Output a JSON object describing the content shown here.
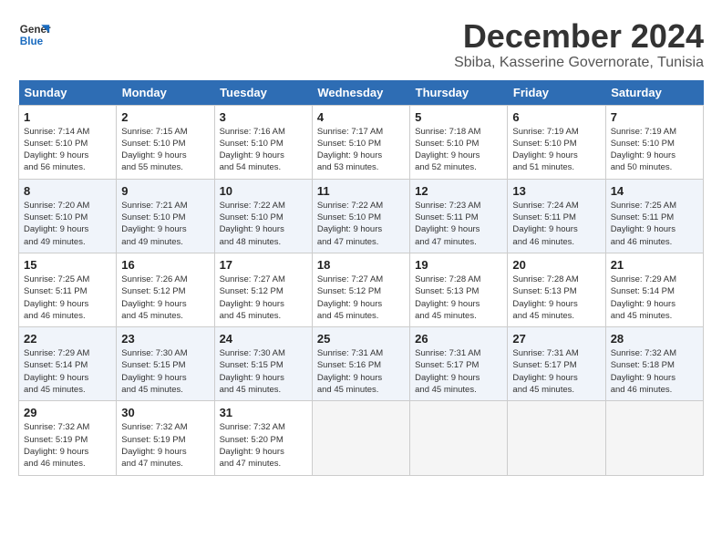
{
  "header": {
    "logo_line1": "General",
    "logo_line2": "Blue",
    "month": "December 2024",
    "location": "Sbiba, Kasserine Governorate, Tunisia"
  },
  "weekdays": [
    "Sunday",
    "Monday",
    "Tuesday",
    "Wednesday",
    "Thursday",
    "Friday",
    "Saturday"
  ],
  "weeks": [
    [
      {
        "day": "1",
        "info": "Sunrise: 7:14 AM\nSunset: 5:10 PM\nDaylight: 9 hours\nand 56 minutes."
      },
      {
        "day": "2",
        "info": "Sunrise: 7:15 AM\nSunset: 5:10 PM\nDaylight: 9 hours\nand 55 minutes."
      },
      {
        "day": "3",
        "info": "Sunrise: 7:16 AM\nSunset: 5:10 PM\nDaylight: 9 hours\nand 54 minutes."
      },
      {
        "day": "4",
        "info": "Sunrise: 7:17 AM\nSunset: 5:10 PM\nDaylight: 9 hours\nand 53 minutes."
      },
      {
        "day": "5",
        "info": "Sunrise: 7:18 AM\nSunset: 5:10 PM\nDaylight: 9 hours\nand 52 minutes."
      },
      {
        "day": "6",
        "info": "Sunrise: 7:19 AM\nSunset: 5:10 PM\nDaylight: 9 hours\nand 51 minutes."
      },
      {
        "day": "7",
        "info": "Sunrise: 7:19 AM\nSunset: 5:10 PM\nDaylight: 9 hours\nand 50 minutes."
      }
    ],
    [
      {
        "day": "8",
        "info": "Sunrise: 7:20 AM\nSunset: 5:10 PM\nDaylight: 9 hours\nand 49 minutes."
      },
      {
        "day": "9",
        "info": "Sunrise: 7:21 AM\nSunset: 5:10 PM\nDaylight: 9 hours\nand 49 minutes."
      },
      {
        "day": "10",
        "info": "Sunrise: 7:22 AM\nSunset: 5:10 PM\nDaylight: 9 hours\nand 48 minutes."
      },
      {
        "day": "11",
        "info": "Sunrise: 7:22 AM\nSunset: 5:10 PM\nDaylight: 9 hours\nand 47 minutes."
      },
      {
        "day": "12",
        "info": "Sunrise: 7:23 AM\nSunset: 5:11 PM\nDaylight: 9 hours\nand 47 minutes."
      },
      {
        "day": "13",
        "info": "Sunrise: 7:24 AM\nSunset: 5:11 PM\nDaylight: 9 hours\nand 46 minutes."
      },
      {
        "day": "14",
        "info": "Sunrise: 7:25 AM\nSunset: 5:11 PM\nDaylight: 9 hours\nand 46 minutes."
      }
    ],
    [
      {
        "day": "15",
        "info": "Sunrise: 7:25 AM\nSunset: 5:11 PM\nDaylight: 9 hours\nand 46 minutes."
      },
      {
        "day": "16",
        "info": "Sunrise: 7:26 AM\nSunset: 5:12 PM\nDaylight: 9 hours\nand 45 minutes."
      },
      {
        "day": "17",
        "info": "Sunrise: 7:27 AM\nSunset: 5:12 PM\nDaylight: 9 hours\nand 45 minutes."
      },
      {
        "day": "18",
        "info": "Sunrise: 7:27 AM\nSunset: 5:12 PM\nDaylight: 9 hours\nand 45 minutes."
      },
      {
        "day": "19",
        "info": "Sunrise: 7:28 AM\nSunset: 5:13 PM\nDaylight: 9 hours\nand 45 minutes."
      },
      {
        "day": "20",
        "info": "Sunrise: 7:28 AM\nSunset: 5:13 PM\nDaylight: 9 hours\nand 45 minutes."
      },
      {
        "day": "21",
        "info": "Sunrise: 7:29 AM\nSunset: 5:14 PM\nDaylight: 9 hours\nand 45 minutes."
      }
    ],
    [
      {
        "day": "22",
        "info": "Sunrise: 7:29 AM\nSunset: 5:14 PM\nDaylight: 9 hours\nand 45 minutes."
      },
      {
        "day": "23",
        "info": "Sunrise: 7:30 AM\nSunset: 5:15 PM\nDaylight: 9 hours\nand 45 minutes."
      },
      {
        "day": "24",
        "info": "Sunrise: 7:30 AM\nSunset: 5:15 PM\nDaylight: 9 hours\nand 45 minutes."
      },
      {
        "day": "25",
        "info": "Sunrise: 7:31 AM\nSunset: 5:16 PM\nDaylight: 9 hours\nand 45 minutes."
      },
      {
        "day": "26",
        "info": "Sunrise: 7:31 AM\nSunset: 5:17 PM\nDaylight: 9 hours\nand 45 minutes."
      },
      {
        "day": "27",
        "info": "Sunrise: 7:31 AM\nSunset: 5:17 PM\nDaylight: 9 hours\nand 45 minutes."
      },
      {
        "day": "28",
        "info": "Sunrise: 7:32 AM\nSunset: 5:18 PM\nDaylight: 9 hours\nand 46 minutes."
      }
    ],
    [
      {
        "day": "29",
        "info": "Sunrise: 7:32 AM\nSunset: 5:19 PM\nDaylight: 9 hours\nand 46 minutes."
      },
      {
        "day": "30",
        "info": "Sunrise: 7:32 AM\nSunset: 5:19 PM\nDaylight: 9 hours\nand 47 minutes."
      },
      {
        "day": "31",
        "info": "Sunrise: 7:32 AM\nSunset: 5:20 PM\nDaylight: 9 hours\nand 47 minutes."
      },
      null,
      null,
      null,
      null
    ]
  ]
}
